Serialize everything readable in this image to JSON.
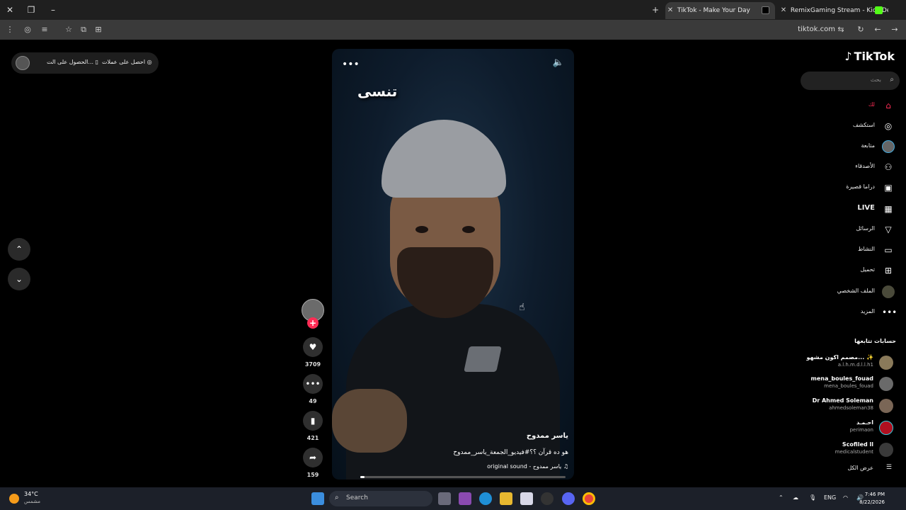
{
  "browser": {
    "tabs": [
      {
        "title": "TikTok - Make Your Day",
        "active": true
      },
      {
        "title": "RemixGaming Stream - Kick De",
        "active": false
      }
    ],
    "new_tab_label": "+",
    "url": "tiktok.com"
  },
  "promo": {
    "get_coins": "احصل على عملات",
    "get_app": "الحصول على الت..."
  },
  "video": {
    "overlay_text": "تنسى",
    "author": "ياسر ممدوح",
    "description": "هو ده قرآن ؟؟#فيديو_الجمعة_ياسر_ممدوح",
    "sound": "original sound - ياسر ممدوح",
    "progress": 0.02
  },
  "actions": {
    "likes": "3709",
    "comments": "49",
    "saves": "421",
    "shares": "159"
  },
  "sidebar": {
    "logo": "TikTok",
    "search_placeholder": "بحث",
    "nav": [
      {
        "label": "لك",
        "icon": "home-icon",
        "active": true
      },
      {
        "label": "استكشف",
        "icon": "compass-icon"
      },
      {
        "label": "متابعة",
        "icon": "avatar-icon"
      },
      {
        "label": "الأصدقاء",
        "icon": "friends-icon"
      },
      {
        "label": "دراما قصيرة",
        "icon": "drama-icon"
      },
      {
        "label": "LIVE",
        "icon": "live-icon"
      },
      {
        "label": "الرسائل",
        "icon": "send-icon"
      },
      {
        "label": "النشاط",
        "icon": "activity-icon"
      },
      {
        "label": "تحميل",
        "icon": "upload-icon"
      },
      {
        "label": "الملف الشخصي",
        "icon": "profile-icon"
      },
      {
        "label": "المزيد",
        "icon": "more-icon"
      }
    ],
    "following_title": "حسابات تتابعها",
    "accounts": [
      {
        "name": "مصمم اكون مشهو... ✨",
        "username": "a.l.h.m.d.l.l.h1"
      },
      {
        "name": "mena_boules_fouad",
        "username": "mena_boules_fouad"
      },
      {
        "name": "Dr Ahmed Soleman",
        "username": "ahmedsoleman38"
      },
      {
        "name": "احـمـد",
        "username": "perimaon"
      },
      {
        "name": "Scofiled ll",
        "username": "medicalstudent"
      }
    ],
    "see_all": "عرض الكل"
  },
  "taskbar": {
    "temperature": "34°C",
    "weather": "مشمس",
    "search_label": "Search",
    "language": "ENG",
    "time": "7:46 PM",
    "date": "8/22/2026"
  }
}
